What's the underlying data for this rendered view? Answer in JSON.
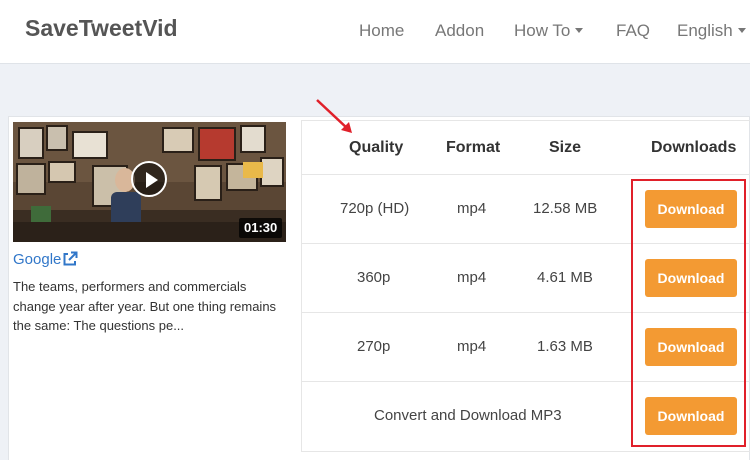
{
  "brand": "SaveTweetVid",
  "nav": {
    "home": "Home",
    "addon": "Addon",
    "how_to": "How To",
    "faq": "FAQ",
    "language": "English"
  },
  "video": {
    "duration": "01:30",
    "source": "Google",
    "description": "The teams, performers and commercials change year after year. But one thing remains the same: The questions pe..."
  },
  "table": {
    "headers": [
      "Quality",
      "Format",
      "Size",
      "Downloads"
    ],
    "rows": [
      {
        "quality": "720p (HD)",
        "format": "mp4",
        "size": "12.58 MB",
        "action": "Download"
      },
      {
        "quality": "360p",
        "format": "mp4",
        "size": "4.61 MB",
        "action": "Download"
      },
      {
        "quality": "270p",
        "format": "mp4",
        "size": "1.63 MB",
        "action": "Download"
      }
    ],
    "mp3_label": "Convert and Download MP3",
    "mp3_action": "Download"
  },
  "colors": {
    "button": "#f39a33",
    "link": "#3177c9",
    "annotation": "#e0202a"
  }
}
